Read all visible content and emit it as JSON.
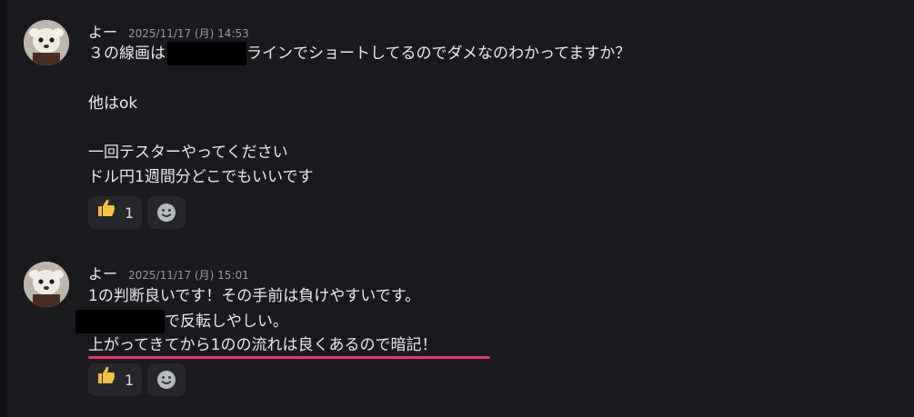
{
  "messages": [
    {
      "username": "よー",
      "timestamp": "2025/11/17 (月) 14:53",
      "lines": {
        "l1_a": "３の線画は",
        "l1_b": "ラインでショートしてるのでダメなのわかってますか？",
        "l2": "他はok",
        "l3": "一回テスターやってください",
        "l4": "ドル円1週間分どこでもいいです"
      },
      "reaction": {
        "emoji": "thumbs-up",
        "count": "1"
      }
    },
    {
      "username": "よー",
      "timestamp": "2025/11/17 (月) 15:01",
      "lines": {
        "l1": "1の判断良いです！その手前は負けやすいです。",
        "l2": "で反転しやしい。",
        "l3": "上がってきてから1のの流れは良くあるので暗記！"
      },
      "reaction": {
        "emoji": "thumbs-up",
        "count": "1"
      }
    }
  ],
  "colors": {
    "background": "#1a1a1e",
    "underline_accent": "#e8356e",
    "reaction_bg": "#26272b"
  },
  "icons": {
    "reaction": "thumbs-up-icon",
    "add_reaction": "smiley-face-icon"
  }
}
